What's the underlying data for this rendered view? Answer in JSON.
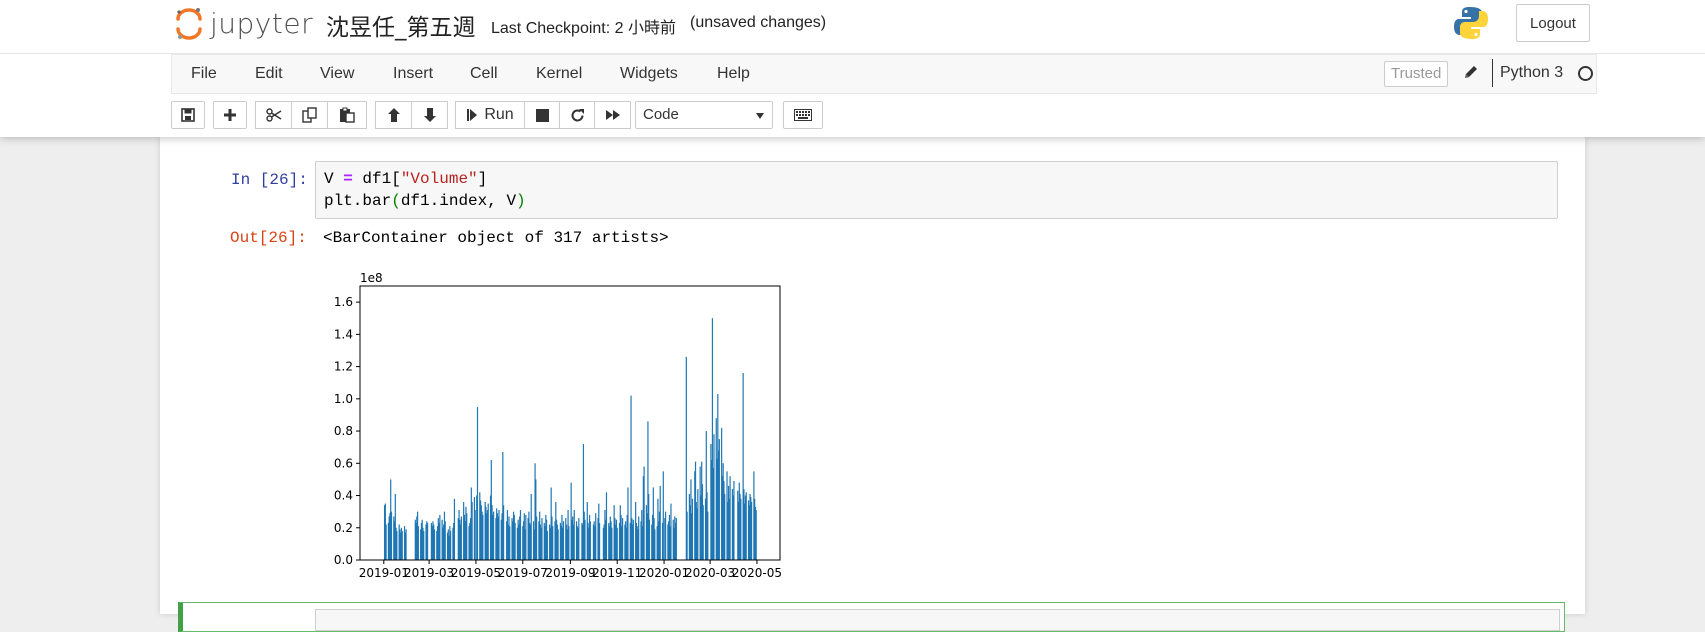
{
  "header": {
    "logo_text": "jupyter",
    "notebook_name": "沈昱任_第五週",
    "checkpoint": "Last Checkpoint: 2 小時前",
    "autosave": "(unsaved changes)",
    "logout_label": "Logout"
  },
  "menubar": {
    "items": [
      "File",
      "Edit",
      "View",
      "Insert",
      "Cell",
      "Kernel",
      "Widgets",
      "Help"
    ],
    "trusted_label": "Trusted",
    "kernel_name": "Python 3"
  },
  "toolbar": {
    "run_label": "Run",
    "cell_type": "Code",
    "icons": [
      "save-icon",
      "plus-icon",
      "cut-icon",
      "copy-icon",
      "paste-icon",
      "arrow-up-icon",
      "arrow-down-icon",
      "run-icon",
      "stop-icon",
      "restart-icon",
      "fast-forward-icon",
      "keyboard-icon"
    ]
  },
  "cell": {
    "in_prompt": "In [26]:",
    "out_prompt": "Out[26]:",
    "code_line1_a": "V ",
    "code_line1_op": "=",
    "code_line1_b": " df1[",
    "code_line1_str": "\"Volume\"",
    "code_line1_c": "]",
    "code_line2_a": "plt.bar",
    "code_line2_b": "(",
    "code_line2_c": "df1.index, V",
    "code_line2_d": ")",
    "output_text": "<BarContainer object of 317 artists>"
  },
  "chart_data": {
    "type": "bar",
    "title": "",
    "xlabel": "",
    "ylabel": "",
    "offset_label": "1e8",
    "ylim": [
      0,
      1.7
    ],
    "yticks": [
      "0.0",
      "0.2",
      "0.4",
      "0.6",
      "0.8",
      "1.0",
      "1.2",
      "1.4",
      "1.6"
    ],
    "xticks": [
      "2019-01",
      "2019-03",
      "2019-05",
      "2019-07",
      "2019-09",
      "2019-11",
      "2020-01",
      "2020-03",
      "2020-05"
    ],
    "xlim": [
      "2018-12-01",
      "2020-05-31"
    ],
    "color": "#1f77b4",
    "series": [
      {
        "dates": [
          "2019-01-02",
          "2019-01-03",
          "2019-01-04",
          "2019-01-07",
          "2019-01-08",
          "2019-01-09",
          "2019-01-10",
          "2019-01-11",
          "2019-01-14",
          "2019-01-15",
          "2019-01-16",
          "2019-01-17",
          "2019-01-18",
          "2019-01-21",
          "2019-01-22",
          "2019-01-23",
          "2019-01-24",
          "2019-01-25",
          "2019-01-28",
          "2019-01-29",
          "2019-01-30",
          "2019-02-11",
          "2019-02-12",
          "2019-02-13",
          "2019-02-14",
          "2019-02-15",
          "2019-02-18",
          "2019-02-19",
          "2019-02-20",
          "2019-02-21",
          "2019-02-22",
          "2019-02-25",
          "2019-02-26",
          "2019-02-27",
          "2019-03-04",
          "2019-03-05",
          "2019-03-06",
          "2019-03-07",
          "2019-03-08",
          "2019-03-11",
          "2019-03-12",
          "2019-03-13",
          "2019-03-14",
          "2019-03-15",
          "2019-03-18",
          "2019-03-19",
          "2019-03-20",
          "2019-03-21",
          "2019-03-22",
          "2019-03-25",
          "2019-03-26",
          "2019-03-27",
          "2019-03-28",
          "2019-03-29",
          "2019-04-01",
          "2019-04-02",
          "2019-04-03",
          "2019-04-08",
          "2019-04-09",
          "2019-04-10",
          "2019-04-11",
          "2019-04-12",
          "2019-04-15",
          "2019-04-16",
          "2019-04-17",
          "2019-04-18",
          "2019-04-19",
          "2019-04-22",
          "2019-04-23",
          "2019-04-24",
          "2019-04-25",
          "2019-04-26",
          "2019-04-29",
          "2019-04-30",
          "2019-05-02",
          "2019-05-03",
          "2019-05-06",
          "2019-05-07",
          "2019-05-08",
          "2019-05-09",
          "2019-05-10",
          "2019-05-13",
          "2019-05-14",
          "2019-05-15",
          "2019-05-16",
          "2019-05-17",
          "2019-05-20",
          "2019-05-21",
          "2019-05-22",
          "2019-05-23",
          "2019-05-24",
          "2019-05-27",
          "2019-05-28",
          "2019-05-29",
          "2019-05-30",
          "2019-05-31",
          "2019-06-03",
          "2019-06-04",
          "2019-06-05",
          "2019-06-06",
          "2019-06-10",
          "2019-06-11",
          "2019-06-12",
          "2019-06-13",
          "2019-06-14",
          "2019-06-17",
          "2019-06-18",
          "2019-06-19",
          "2019-06-20",
          "2019-06-21",
          "2019-06-24",
          "2019-06-25",
          "2019-06-26",
          "2019-06-27",
          "2019-06-28",
          "2019-07-01",
          "2019-07-02",
          "2019-07-03",
          "2019-07-04",
          "2019-07-05",
          "2019-07-08",
          "2019-07-09",
          "2019-07-10",
          "2019-07-11",
          "2019-07-12",
          "2019-07-15",
          "2019-07-16",
          "2019-07-17",
          "2019-07-18",
          "2019-07-19",
          "2019-07-22",
          "2019-07-23",
          "2019-07-24",
          "2019-07-25",
          "2019-07-26",
          "2019-07-29",
          "2019-07-30",
          "2019-07-31",
          "2019-08-01",
          "2019-08-02",
          "2019-08-05",
          "2019-08-06",
          "2019-08-07",
          "2019-08-08",
          "2019-08-09",
          "2019-08-12",
          "2019-08-13",
          "2019-08-14",
          "2019-08-15",
          "2019-08-16",
          "2019-08-19",
          "2019-08-20",
          "2019-08-21",
          "2019-08-22",
          "2019-08-23",
          "2019-08-26",
          "2019-08-27",
          "2019-08-28",
          "2019-08-29",
          "2019-08-30",
          "2019-09-02",
          "2019-09-03",
          "2019-09-04",
          "2019-09-05",
          "2019-09-06",
          "2019-09-09",
          "2019-09-10",
          "2019-09-11",
          "2019-09-12",
          "2019-09-16",
          "2019-09-17",
          "2019-09-18",
          "2019-09-19",
          "2019-09-20",
          "2019-09-23",
          "2019-09-24",
          "2019-09-25",
          "2019-09-26",
          "2019-09-27",
          "2019-10-01",
          "2019-10-02",
          "2019-10-03",
          "2019-10-04",
          "2019-10-07",
          "2019-10-08",
          "2019-10-09",
          "2019-10-14",
          "2019-10-15",
          "2019-10-16",
          "2019-10-17",
          "2019-10-18",
          "2019-10-21",
          "2019-10-22",
          "2019-10-23",
          "2019-10-24",
          "2019-10-25",
          "2019-10-28",
          "2019-10-29",
          "2019-10-30",
          "2019-10-31",
          "2019-11-01",
          "2019-11-04",
          "2019-11-05",
          "2019-11-06",
          "2019-11-07",
          "2019-11-08",
          "2019-11-11",
          "2019-11-12",
          "2019-11-13",
          "2019-11-14",
          "2019-11-15",
          "2019-11-18",
          "2019-11-19",
          "2019-11-20",
          "2019-11-21",
          "2019-11-22",
          "2019-11-25",
          "2019-11-26",
          "2019-11-27",
          "2019-11-28",
          "2019-11-29",
          "2019-12-02",
          "2019-12-03",
          "2019-12-04",
          "2019-12-05",
          "2019-12-06",
          "2019-12-09",
          "2019-12-10",
          "2019-12-11",
          "2019-12-12",
          "2019-12-13",
          "2019-12-16",
          "2019-12-17",
          "2019-12-18",
          "2019-12-19",
          "2019-12-20",
          "2019-12-23",
          "2019-12-24",
          "2019-12-25",
          "2019-12-26",
          "2019-12-27",
          "2019-12-30",
          "2019-12-31",
          "2020-01-02",
          "2020-01-03",
          "2020-01-06",
          "2020-01-07",
          "2020-01-08",
          "2020-01-09",
          "2020-01-10",
          "2020-01-13",
          "2020-01-14",
          "2020-01-15",
          "2020-01-16",
          "2020-01-17",
          "2020-01-30",
          "2020-01-31",
          "2020-02-03",
          "2020-02-04",
          "2020-02-05",
          "2020-02-06",
          "2020-02-07",
          "2020-02-10",
          "2020-02-11",
          "2020-02-12",
          "2020-02-13",
          "2020-02-14",
          "2020-02-17",
          "2020-02-18",
          "2020-02-19",
          "2020-02-20",
          "2020-02-21",
          "2020-02-24",
          "2020-02-25",
          "2020-02-26",
          "2020-02-27",
          "2020-03-02",
          "2020-03-03",
          "2020-03-04",
          "2020-03-05",
          "2020-03-06",
          "2020-03-09",
          "2020-03-10",
          "2020-03-11",
          "2020-03-12",
          "2020-03-13",
          "2020-03-16",
          "2020-03-17",
          "2020-03-18",
          "2020-03-19",
          "2020-03-20",
          "2020-03-23",
          "2020-03-24",
          "2020-03-25",
          "2020-03-26",
          "2020-03-27",
          "2020-03-30",
          "2020-03-31",
          "2020-04-01",
          "2020-04-06",
          "2020-04-07",
          "2020-04-08",
          "2020-04-09",
          "2020-04-10",
          "2020-04-13",
          "2020-04-14",
          "2020-04-15",
          "2020-04-16",
          "2020-04-17",
          "2020-04-20",
          "2020-04-21",
          "2020-04-22",
          "2020-04-23",
          "2020-04-24",
          "2020-04-27",
          "2020-04-28",
          "2020-04-29",
          "2020-04-30"
        ],
        "values": [
          0.34,
          0.35,
          0.22,
          0.23,
          0.27,
          0.29,
          0.5,
          0.3,
          0.27,
          0.24,
          0.41,
          0.2,
          0.18,
          0.22,
          0.19,
          0.17,
          0.2,
          0.18,
          0.21,
          0.17,
          0.19,
          0.25,
          0.23,
          0.27,
          0.3,
          0.21,
          0.19,
          0.23,
          0.25,
          0.2,
          0.18,
          0.22,
          0.24,
          0.23,
          0.23,
          0.21,
          0.24,
          0.22,
          0.19,
          0.18,
          0.21,
          0.26,
          0.23,
          0.28,
          0.25,
          0.2,
          0.22,
          0.3,
          0.24,
          0.17,
          0.19,
          0.15,
          0.21,
          0.18,
          0.2,
          0.23,
          0.38,
          0.26,
          0.31,
          0.25,
          0.22,
          0.27,
          0.36,
          0.28,
          0.24,
          0.33,
          0.29,
          0.21,
          0.23,
          0.26,
          0.45,
          0.36,
          0.39,
          0.31,
          0.4,
          0.95,
          0.42,
          0.37,
          0.34,
          0.3,
          0.28,
          0.36,
          0.33,
          0.29,
          0.31,
          0.35,
          0.4,
          0.62,
          0.34,
          0.28,
          0.3,
          0.26,
          0.32,
          0.29,
          0.27,
          0.31,
          0.25,
          0.29,
          0.67,
          0.34,
          0.24,
          0.31,
          0.22,
          0.27,
          0.21,
          0.26,
          0.24,
          0.3,
          0.28,
          0.23,
          0.2,
          0.25,
          0.22,
          0.27,
          0.31,
          0.21,
          0.24,
          0.29,
          0.19,
          0.28,
          0.26,
          0.3,
          0.23,
          0.22,
          0.41,
          0.24,
          0.19,
          0.6,
          0.5,
          0.27,
          0.24,
          0.3,
          0.22,
          0.2,
          0.26,
          0.23,
          0.21,
          0.28,
          0.25,
          0.18,
          0.22,
          0.2,
          0.45,
          0.27,
          0.21,
          0.24,
          0.36,
          0.25,
          0.22,
          0.19,
          0.23,
          0.21,
          0.28,
          0.2,
          0.24,
          0.26,
          0.22,
          0.19,
          0.31,
          0.21,
          0.48,
          0.25,
          0.27,
          0.22,
          0.31,
          0.24,
          0.21,
          0.2,
          0.26,
          0.23,
          0.22,
          0.72,
          0.3,
          0.25,
          0.36,
          0.23,
          0.2,
          0.28,
          0.24,
          0.22,
          0.24,
          0.21,
          0.29,
          0.26,
          0.35,
          0.23,
          0.2,
          0.22,
          0.31,
          0.25,
          0.42,
          0.23,
          0.21,
          0.27,
          0.24,
          0.2,
          0.34,
          0.26,
          0.22,
          0.25,
          0.2,
          0.23,
          0.34,
          0.28,
          0.21,
          0.26,
          0.22,
          0.24,
          0.2,
          0.28,
          0.45,
          0.23,
          1.02,
          0.26,
          0.22,
          0.25,
          0.36,
          0.23,
          0.21,
          0.19,
          0.27,
          0.24,
          0.31,
          0.21,
          0.52,
          0.58,
          0.34,
          0.29,
          0.86,
          0.41,
          0.25,
          0.22,
          0.28,
          0.45,
          0.26,
          0.19,
          0.21,
          0.38,
          0.24,
          0.3,
          0.46,
          0.23,
          0.55,
          0.26,
          0.3,
          0.22,
          0.24,
          0.28,
          0.21,
          0.35,
          0.25,
          0.2,
          0.27,
          0.23,
          0.26,
          1.26,
          0.3,
          0.41,
          0.34,
          0.5,
          0.29,
          0.38,
          0.55,
          0.61,
          0.36,
          0.32,
          0.44,
          0.58,
          0.4,
          0.61,
          0.47,
          0.34,
          0.38,
          0.8,
          0.42,
          0.3,
          0.72,
          0.62,
          1.5,
          0.57,
          0.78,
          0.88,
          0.63,
          1.03,
          0.68,
          0.75,
          0.82,
          0.52,
          0.6,
          0.49,
          0.41,
          0.55,
          0.36,
          0.46,
          0.38,
          0.52,
          0.44,
          0.4,
          0.49,
          0.43,
          0.36,
          0.48,
          0.41,
          0.38,
          1.16,
          0.44,
          0.35,
          0.4,
          0.42,
          0.37,
          0.34,
          0.41,
          0.39,
          0.36,
          0.55,
          0.38,
          0.33,
          0.31
        ]
      }
    ]
  }
}
